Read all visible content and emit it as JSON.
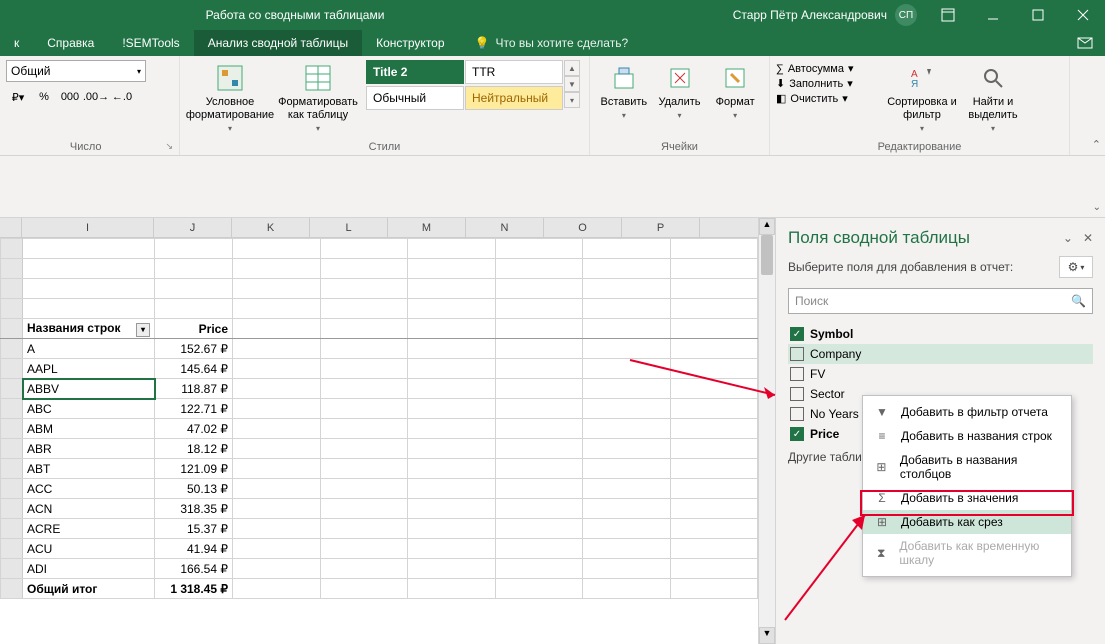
{
  "titlebar": {
    "context_title": "Работа со сводными таблицами",
    "user_name": "Старр Пётр Александрович",
    "user_initials": "СП"
  },
  "tabs": {
    "items": [
      "к",
      "Справка",
      "!SEMTools",
      "Анализ сводной таблицы",
      "Конструктор"
    ],
    "tell_me": "Что вы хотите сделать?"
  },
  "ribbon": {
    "number_format": "Общий",
    "groups": {
      "number": "Число",
      "styles": "Стили",
      "cells": "Ячейки",
      "editing": "Редактирование"
    },
    "btn_conditional": "Условное форматирование",
    "btn_format_table": "Форматировать как таблицу",
    "style_title2": "Title 2",
    "style_ttr": "TTR",
    "style_normal": "Обычный",
    "style_neutral": "Нейтральный",
    "btn_insert": "Вставить",
    "btn_delete": "Удалить",
    "btn_format": "Формат",
    "edit_autosum": "Автосумма",
    "edit_fill": "Заполнить",
    "edit_clear": "Очистить",
    "btn_sort": "Сортировка и фильтр",
    "btn_find": "Найти и выделить"
  },
  "columns": [
    "I",
    "J",
    "K",
    "L",
    "M",
    "N",
    "O",
    "P"
  ],
  "pivot": {
    "header_rows": "Названия строк",
    "header_price": "Price",
    "rows": [
      {
        "label": "A",
        "price": "152.67 ₽"
      },
      {
        "label": "AAPL",
        "price": "145.64 ₽"
      },
      {
        "label": "ABBV",
        "price": "118.87 ₽"
      },
      {
        "label": "ABC",
        "price": "122.71 ₽"
      },
      {
        "label": "ABM",
        "price": "47.02 ₽"
      },
      {
        "label": "ABR",
        "price": "18.12 ₽"
      },
      {
        "label": "ABT",
        "price": "121.09 ₽"
      },
      {
        "label": "ACC",
        "price": "50.13 ₽"
      },
      {
        "label": "ACN",
        "price": "318.35 ₽"
      },
      {
        "label": "ACRE",
        "price": "15.37 ₽"
      },
      {
        "label": "ACU",
        "price": "41.94 ₽"
      },
      {
        "label": "ADI",
        "price": "166.54 ₽"
      }
    ],
    "total_label": "Общий итог",
    "total_price": "1 318.45 ₽"
  },
  "pane": {
    "title": "Поля сводной таблицы",
    "subtitle": "Выберите поля для добавления в отчет:",
    "search_placeholder": "Поиск",
    "fields": [
      {
        "name": "Symbol",
        "checked": true
      },
      {
        "name": "Company",
        "checked": false,
        "hover": true
      },
      {
        "name": "FV",
        "checked": false
      },
      {
        "name": "Sector",
        "checked": false
      },
      {
        "name": "No Years",
        "checked": false
      },
      {
        "name": "Price",
        "checked": true
      }
    ],
    "other_tables": "Другие таблицы..."
  },
  "ctx": {
    "items": [
      {
        "icon": "▼",
        "label": "Добавить в фильтр отчета"
      },
      {
        "icon": "≡",
        "label": "Добавить в названия строк"
      },
      {
        "icon": "⊞",
        "label": "Добавить в названия столбцов"
      },
      {
        "icon": "Σ",
        "label": "Добавить в значения"
      },
      {
        "icon": "⊞",
        "label": "Добавить как срез",
        "hover": true
      },
      {
        "icon": "⧗",
        "label": "Добавить как временную шкалу",
        "disabled": true
      }
    ]
  }
}
